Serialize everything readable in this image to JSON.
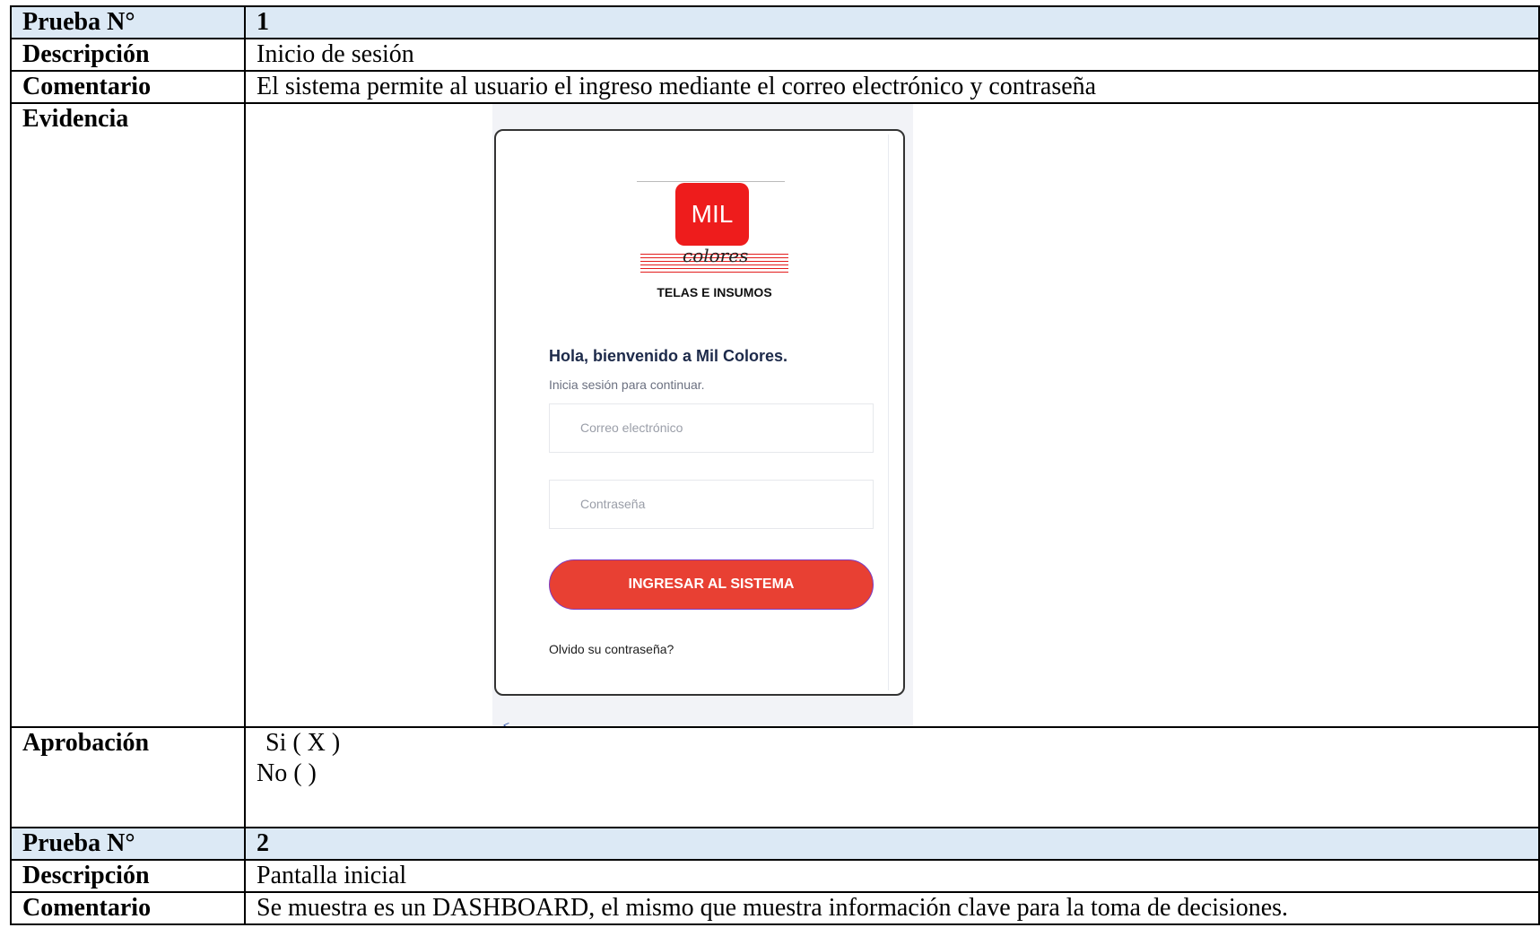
{
  "test1": {
    "label_num": "Prueba N°",
    "num": "1",
    "label_desc": "Descripción",
    "desc": "Inicio de sesión",
    "label_comment": "Comentario",
    "comment": "El sistema permite al usuario el ingreso mediante el correo electrónico y contraseña",
    "label_evidence": "Evidencia",
    "label_approval": "Aprobación",
    "approval_yes": "Si  ( X )",
    "approval_no": "No (     )"
  },
  "screenshot": {
    "logo_main": "MIL",
    "logo_script": "colores",
    "logo_sub": "TELAS E INSUMOS",
    "greeting": "Hola, bienvenido a Mil Colores.",
    "subtitle": "Inicia sesión para continuar.",
    "email_placeholder": "Correo electrónico",
    "password_placeholder": "Contraseña",
    "login_button": "INGRESAR AL SISTEMA",
    "forgot_link": "Olvido su contraseña?",
    "back_glyph": "<"
  },
  "test2": {
    "label_num": "Prueba N°",
    "num": "2",
    "label_desc": "Descripción",
    "desc": "Pantalla inicial",
    "label_comment": "Comentario",
    "comment": "Se muestra es un DASHBOARD, el mismo que muestra información clave para la toma de decisiones."
  },
  "colors": {
    "header_bg": "#dce9f5",
    "brand_red": "#ee1c1c",
    "button_red": "#e84033"
  }
}
